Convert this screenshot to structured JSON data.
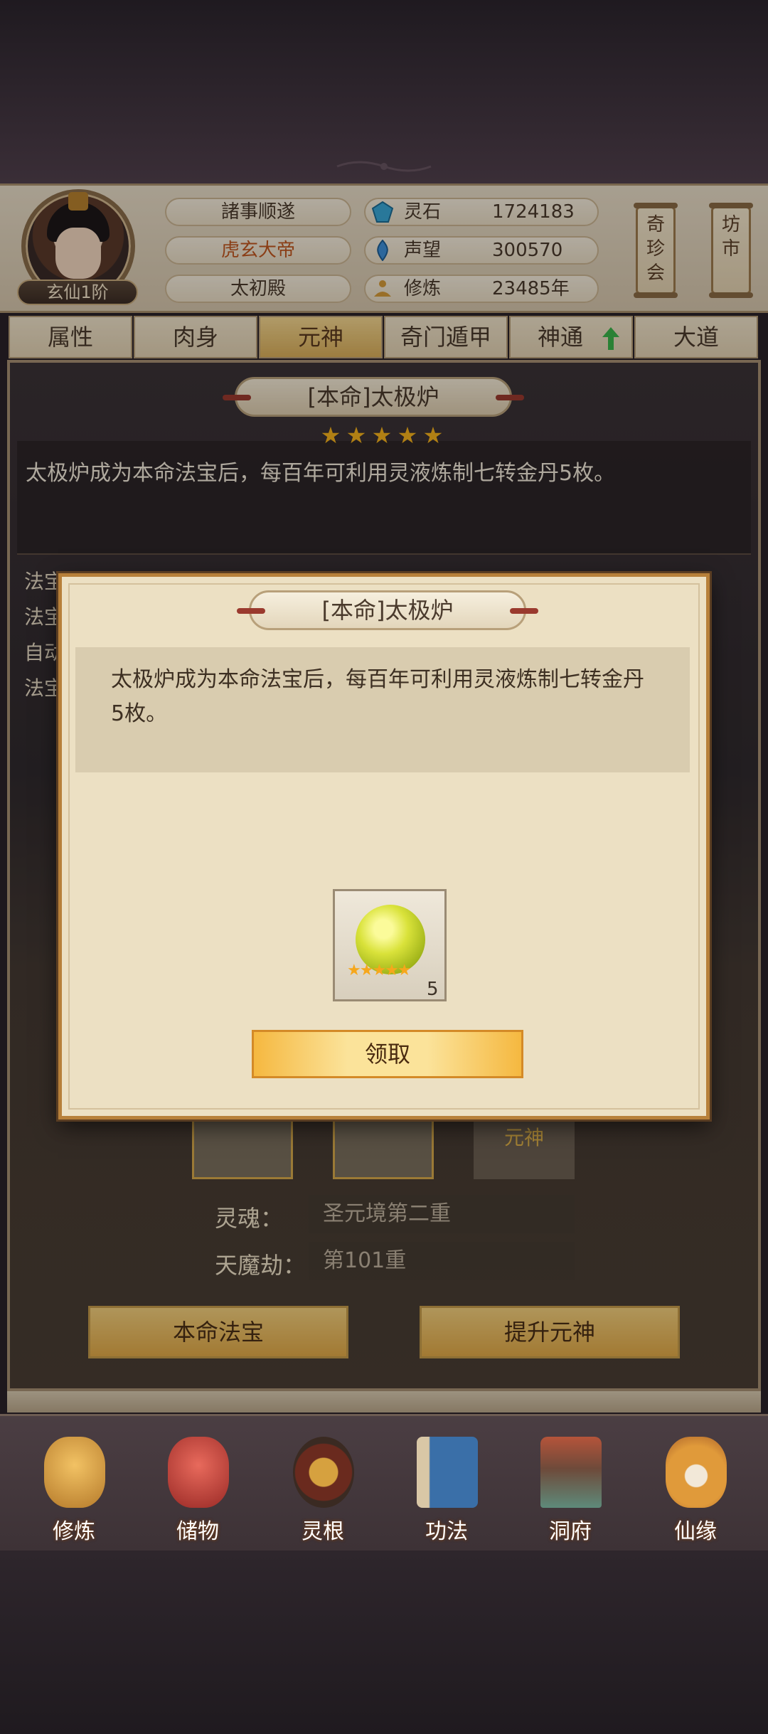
{
  "header": {
    "rank": "玄仙1阶",
    "pills": [
      "諸事顺遂",
      "虎玄大帝",
      "太初殿"
    ],
    "stats": [
      {
        "label": "灵石",
        "value": "1724183",
        "icon": "spirit-stone-icon"
      },
      {
        "label": "声望",
        "value": "300570",
        "icon": "prestige-icon"
      },
      {
        "label": "修炼",
        "value": "23485年",
        "icon": "meditation-icon"
      }
    ],
    "side_buttons": [
      "奇\n珍\n会",
      "坊\n市"
    ]
  },
  "tabs": [
    "属性",
    "肉身",
    "元神",
    "奇门遁甲",
    "神通",
    "大道"
  ],
  "background": {
    "title": "[本命]太极炉",
    "stars": 5,
    "description": "太极炉成为本命法宝后，每百年可利用灵液炼制七转金丹5枚。",
    "side_labels": [
      "法宝",
      "法宝",
      "自动",
      "法宝"
    ],
    "slot_label": "元神",
    "fields": [
      {
        "label": "灵魂：",
        "value": "圣元境第二重"
      },
      {
        "label": "天魔劫：",
        "value": "第101重"
      }
    ],
    "buttons": [
      "本命法宝",
      "提升元神"
    ]
  },
  "popup": {
    "title": "[本命]太极炉",
    "description": "太极炉成为本命法宝后，每百年可利用灵液炼制七转金丹5枚。",
    "reward": {
      "icon": "golden-pill-orb-icon",
      "stars": 5,
      "count": "5"
    },
    "claim_label": "领取"
  },
  "bottom_nav": [
    {
      "label": "修炼",
      "icon": "cultivate-icon",
      "color": "#d6a13f"
    },
    {
      "label": "储物",
      "icon": "storage-bag-icon",
      "color": "#c9473f"
    },
    {
      "label": "灵根",
      "icon": "spirit-root-icon",
      "color": "#8a3a2a"
    },
    {
      "label": "功法",
      "icon": "technique-book-icon",
      "color": "#3a6fa8"
    },
    {
      "label": "洞府",
      "icon": "cave-mansion-icon",
      "color": "#8a5a3a"
    },
    {
      "label": "仙缘",
      "icon": "immortal-fate-icon",
      "color": "#d68a2a"
    }
  ]
}
